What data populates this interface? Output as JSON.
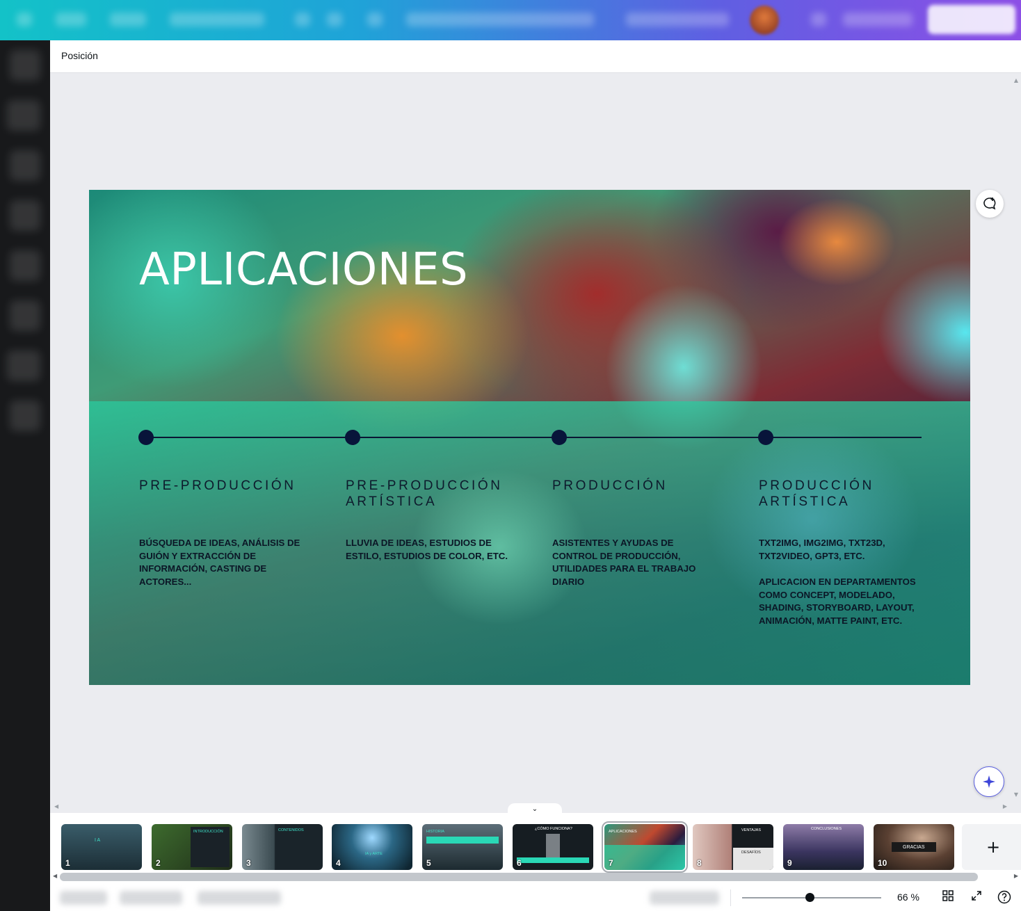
{
  "toolbar": {
    "position_label": "Posición"
  },
  "slide": {
    "title": "APLICACIONES",
    "columns": [
      {
        "title": "PRE-PRODUCCIÓN",
        "body": "BÚSQUEDA DE IDEAS, ANÁLISIS DE GUIÓN Y EXTRACCIÓN DE INFORMACIÓN, CASTING DE ACTORES..."
      },
      {
        "title": "PRE-PRODUCCIÓN ARTÍSTICA",
        "body": "LLUVIA DE IDEAS, ESTUDIOS DE ESTILO, ESTUDIOS DE COLOR, ETC."
      },
      {
        "title": "PRODUCCIÓN",
        "body": "ASISTENTES Y AYUDAS DE CONTROL DE PRODUCCIÓN, UTILIDADES PARA EL TRABAJO DIARIO"
      },
      {
        "title": "PRODUCCIÓN ARTÍSTICA",
        "body": "TXT2IMG, IMG2IMG, TXT23D, TXT2VIDEO, GPT3, ETC.",
        "body2": "APLICACION EN DEPARTAMENTOS COMO CONCEPT, MODELADO, SHADING, STORYBOARD, LAYOUT, ANIMACIÓN, MATTE PAINT, ETC."
      }
    ]
  },
  "pages": [
    {
      "num": "1",
      "caption": "I A"
    },
    {
      "num": "2",
      "caption": "INTRODUCCIÓN"
    },
    {
      "num": "3",
      "caption": "CONTENIDOS"
    },
    {
      "num": "4",
      "caption": "IA y ARTE"
    },
    {
      "num": "5",
      "caption": "HISTORIA"
    },
    {
      "num": "6",
      "caption": "¿CÓMO FUNCIONA?"
    },
    {
      "num": "7",
      "caption": "APLICACIONES"
    },
    {
      "num": "8",
      "caption": "VENTAJAS",
      "caption2": "DESAFÍOS"
    },
    {
      "num": "9",
      "caption": "CONCLUSIONES"
    },
    {
      "num": "10",
      "caption": "GRACIAS"
    }
  ],
  "footer": {
    "zoom_label": "66 %"
  },
  "icons": {
    "comment": "comment-add-icon",
    "magic": "sparkle-icon",
    "add_page": "plus-icon",
    "grid": "grid-view-icon",
    "fullscreen": "fullscreen-icon",
    "help": "help-icon",
    "collapse": "chevron-down-icon"
  }
}
